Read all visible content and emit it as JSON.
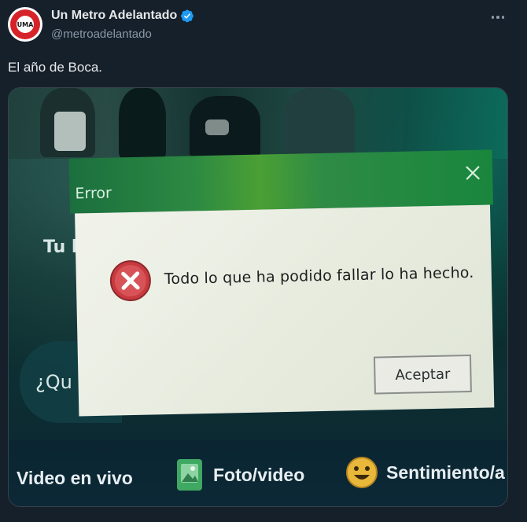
{
  "tweet": {
    "display_name": "Un Metro Adelantado",
    "handle": "@metroadelantado",
    "text": "El año de Boca.",
    "avatar_text": "UMA",
    "verified_color": "#1d9bf0"
  },
  "media": {
    "background_texts": {
      "left_partial": "Tu l",
      "query_partial": "¿Qu"
    },
    "dialog": {
      "title": "Error",
      "message": "Todo lo que ha podido fallar lo ha hecho.",
      "button_label": "Aceptar",
      "title_bar_color": "#2d8a42",
      "icon": "error-x-icon"
    },
    "bottom_bar": {
      "items": [
        {
          "label": "Video en vivo"
        },
        {
          "label": "Foto/video",
          "icon": "photo-icon"
        },
        {
          "label": "Sentimiento/a",
          "icon": "smile-icon"
        }
      ]
    }
  },
  "colors": {
    "background": "#15202b",
    "text_primary": "#e7e9ea",
    "text_secondary": "#8b98a5"
  }
}
